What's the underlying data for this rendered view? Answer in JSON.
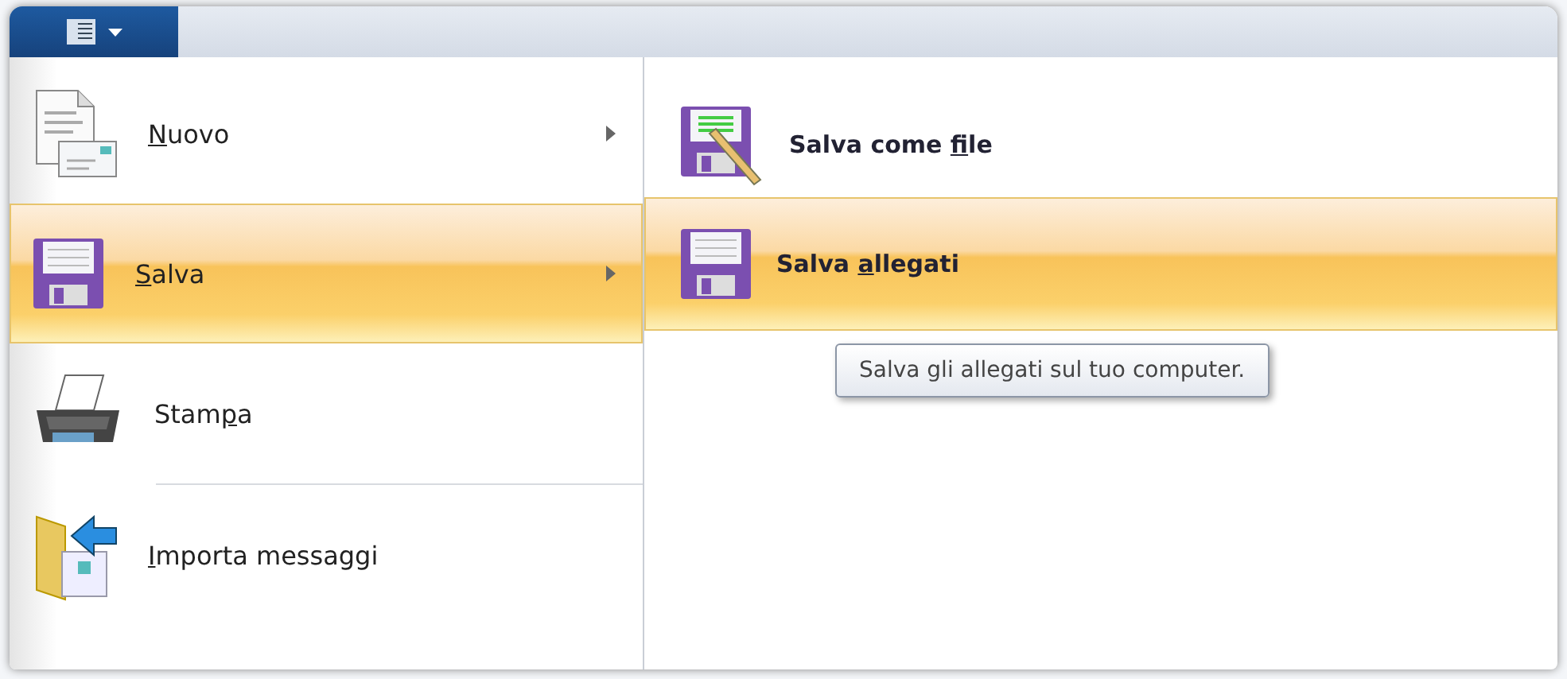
{
  "app_menu_button": {
    "expanded": true
  },
  "menu_items": [
    {
      "label": {
        "key": "N",
        "post": "uovo"
      },
      "has_submenu": true,
      "selected": false,
      "separator_after": false
    },
    {
      "label": {
        "key": "S",
        "post": "alva"
      },
      "has_submenu": true,
      "selected": true,
      "separator_after": false
    },
    {
      "label": {
        "pre": "Stam",
        "key": "p",
        "post": "a"
      },
      "has_submenu": false,
      "selected": false,
      "separator_after": true
    },
    {
      "label": {
        "key": "I",
        "post": "mporta messaggi"
      },
      "has_submenu": false,
      "selected": false,
      "separator_after": false
    }
  ],
  "submenu_items": [
    {
      "label": {
        "pre": "Salva come ",
        "key": "f",
        "post": "ile"
      },
      "selected": false
    },
    {
      "label": {
        "pre": "Salva ",
        "key": "a",
        "post": "llegati"
      },
      "selected": true
    }
  ],
  "tooltip": "Salva gli allegati sul tuo computer."
}
